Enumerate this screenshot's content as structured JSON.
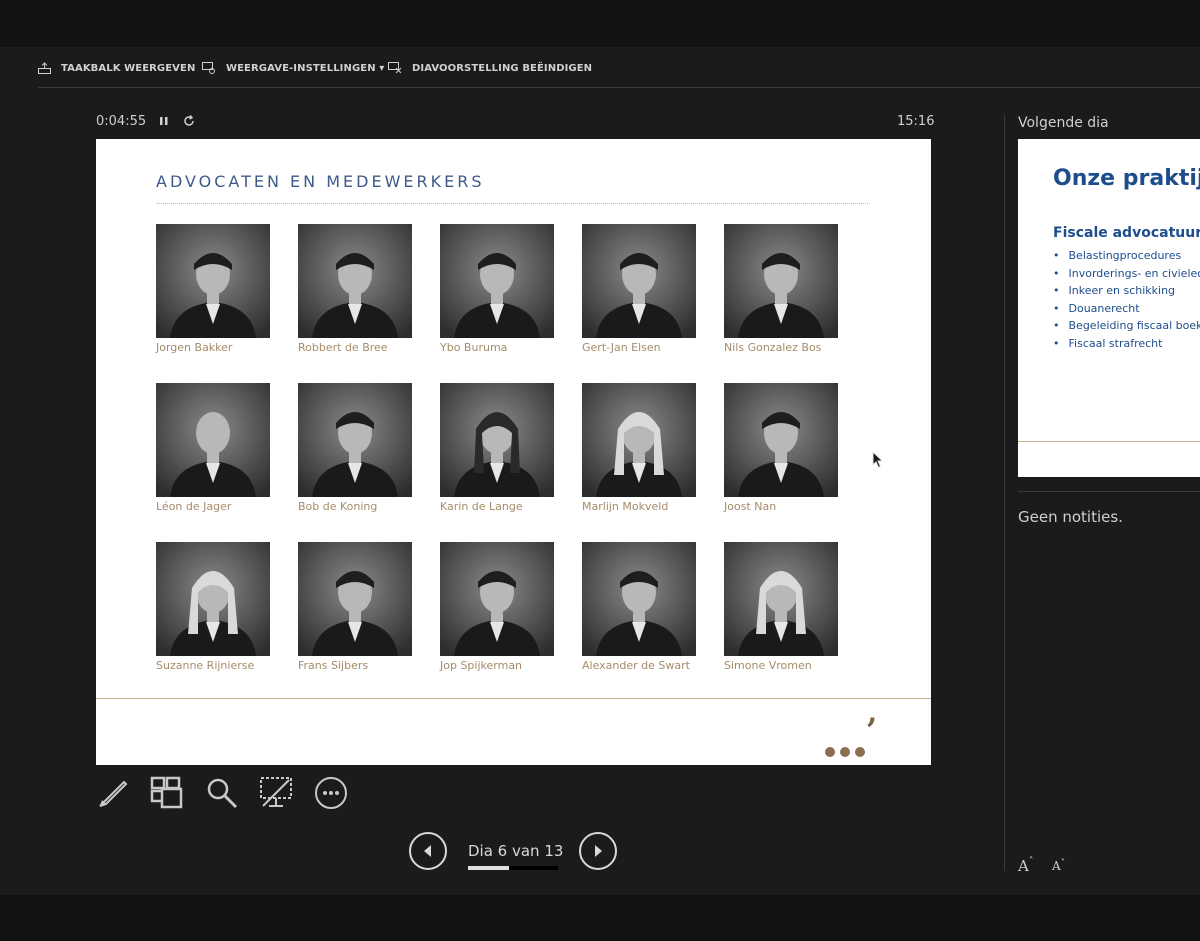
{
  "toolbar": {
    "show_taskbar": "TAAKBALK WEERGEVEN",
    "display_settings": "WEERGAVE-INSTELLINGEN ▾",
    "end_slideshow": "DIAVOORSTELLING BEËINDIGEN"
  },
  "presenter": {
    "elapsed": "0:04:55",
    "clock": "15:16",
    "pause_icon": "pause-icon",
    "restart_icon": "restart-icon"
  },
  "slide": {
    "title": "ADVOCATEN EN MEDEWERKERS",
    "people": [
      {
        "name": "Jorgen Bakker",
        "hair": "dark"
      },
      {
        "name": "Robbert de Bree",
        "hair": "dark"
      },
      {
        "name": "Ybo Buruma",
        "hair": "dark"
      },
      {
        "name": "Gert-Jan Elsen",
        "hair": "dark"
      },
      {
        "name": "Nils Gonzalez Bos",
        "hair": "dark"
      },
      {
        "name": "Léon de Jager",
        "hair": "bald"
      },
      {
        "name": "Bob de Koning",
        "hair": "dark"
      },
      {
        "name": "Karin de Lange",
        "hair": "dark-long"
      },
      {
        "name": "Marlijn Mokveld",
        "hair": "light-long"
      },
      {
        "name": "Joost Nan",
        "hair": "dark"
      },
      {
        "name": "Suzanne Rijnierse",
        "hair": "light-long"
      },
      {
        "name": "Frans Sijbers",
        "hair": "dark"
      },
      {
        "name": "Jop Spijkerman",
        "hair": "dark"
      },
      {
        "name": "Alexander de Swart",
        "hair": "dark"
      },
      {
        "name": "Simone Vromen",
        "hair": "light-long"
      }
    ],
    "logo_mark": ","
  },
  "navigation": {
    "counter": "Dia 6 van 13",
    "progress": 0.46,
    "prev_icon": "chevron-left-icon",
    "next_icon": "chevron-right-icon"
  },
  "tools": [
    "pen-icon",
    "all-slides-icon",
    "zoom-icon",
    "black-screen-icon",
    "more-options-icon"
  ],
  "next_slide": {
    "label": "Volgende dia",
    "title": "Onze praktijk",
    "subtitle": "Fiscale advocatuur",
    "items": [
      "Belastingprocedures",
      "Invorderings- en civielechtelijke",
      "Inkeer en schikking",
      "Douanerecht",
      "Begeleiding fiscaal boekenonderzoek",
      "Fiscaal strafrecht"
    ]
  },
  "notes": "Geen notities.",
  "font_controls": {
    "increase": "A",
    "decrease": "A"
  }
}
